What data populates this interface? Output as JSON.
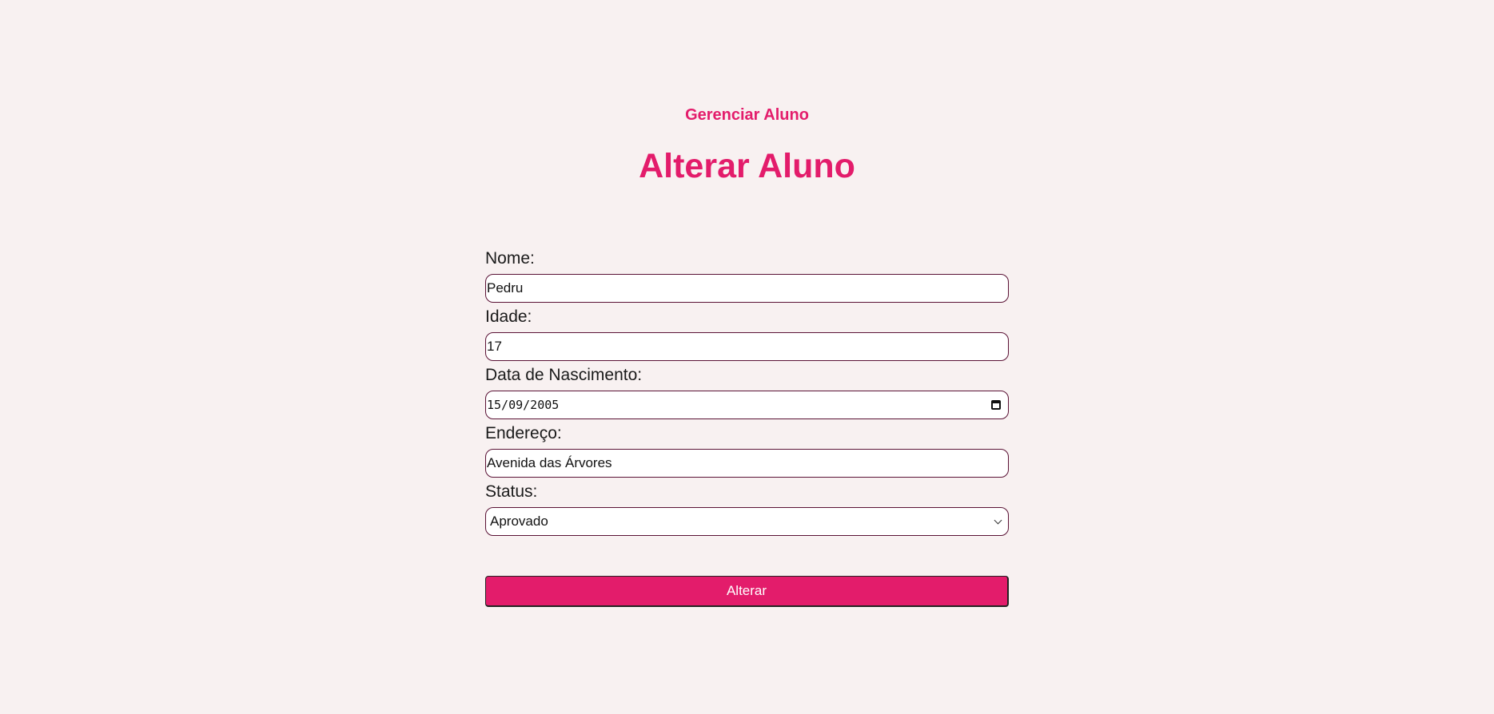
{
  "nav": {
    "link_label": "Gerenciar Aluno"
  },
  "page": {
    "title": "Alterar Aluno"
  },
  "form": {
    "nome": {
      "label": "Nome:",
      "value": "Pedru"
    },
    "idade": {
      "label": "Idade:",
      "value": "17"
    },
    "data_nascimento": {
      "label": "Data de Nascimento:",
      "value": "15/09/2005",
      "icon": "calendar-icon"
    },
    "endereco": {
      "label": "Endereço:",
      "value": "Avenida das Árvores"
    },
    "status": {
      "label": "Status:",
      "selected": "Aprovado",
      "icon": "chevron-down-icon"
    },
    "submit_label": "Alterar"
  },
  "colors": {
    "accent": "#e31c6b",
    "background": "#f8f1f1",
    "field_border": "#5a1235"
  }
}
